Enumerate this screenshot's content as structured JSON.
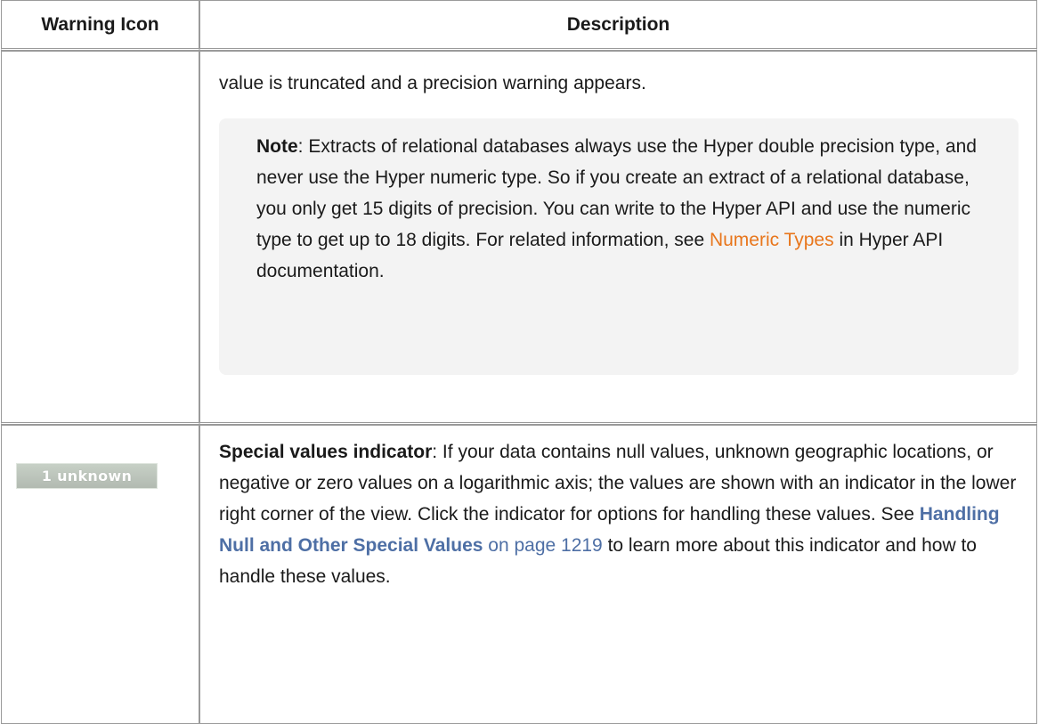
{
  "table": {
    "headers": {
      "icon": "Warning Icon",
      "description": "Description"
    },
    "row1": {
      "text": "value is truncated and a precision warning appears.",
      "note": {
        "label": "Note",
        "text": ": Extracts of relational databases always use the Hyper double precision type, and never use the Hyper numeric type. So if you create an extract of a relational database, you only get 15 digits of precision. You can write to the Hyper API and use the numeric type to get up to 18 digits. For related information, see ",
        "link": "Numeric Types",
        "tail": " in Hyper API documentation."
      }
    },
    "row2": {
      "badge": "1 unknown",
      "title": "Special values indicator",
      "text": ": If your data contains null values, unknown geographic locations, or negative or zero values on a logarithmic axis; the values are shown with an indicator in the lower right corner of the view. Click the indicator for options for handling these values. See ",
      "link": "Handling Null and Other Special Values",
      "page_ref": " on page 1219",
      "tail": " to learn more about this indicator and how to handle these values."
    }
  },
  "colors": {
    "link_orange": "#e8761c",
    "link_blue": "#4e6fa5",
    "note_bg": "#f3f3f3",
    "badge_bg": "#b8c1b7"
  }
}
